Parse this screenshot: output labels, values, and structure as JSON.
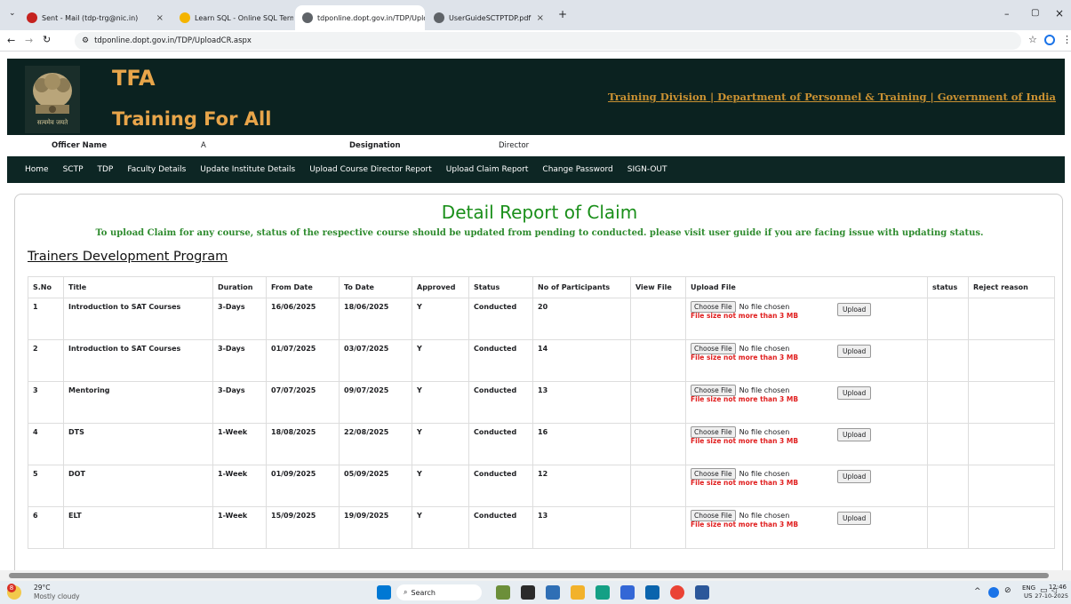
{
  "browser": {
    "tabs": [
      {
        "label": "Sent - Mail (tdp-trg@nic.in)",
        "color": "#c5221f"
      },
      {
        "label": "Learn SQL - Online SQL Termin",
        "color": "#f4b400"
      },
      {
        "label": "tdponline.dopt.gov.in/TDP/Uplo",
        "color": "#5f6368"
      },
      {
        "label": "UserGuideSCTPTDP.pdf",
        "color": "#5f6368"
      }
    ],
    "url": "tdponline.dopt.gov.in/TDP/UploadCR.aspx"
  },
  "header": {
    "logo_text": "TFA",
    "logo_subtext": "Training For All",
    "org": "Training Division | Department of Personnel & Training | Government of India",
    "emblem_caption": "सत्यमेव जयते"
  },
  "officer": {
    "name_label": "Officer Name",
    "name_value": "A",
    "designation_label": "Designation",
    "designation_value": "Director"
  },
  "nav": [
    "Home",
    "SCTP",
    "TDP",
    "Faculty Details",
    "Update Institute Details",
    "Upload Course Director Report",
    "Upload Claim Report",
    "Change Password",
    "SIGN-OUT"
  ],
  "content": {
    "title": "Detail Report of Claim",
    "note": "To upload Claim for any course, status of the respective course should be updated from pending to conducted. please visit user guide if you are facing issue with updating status.",
    "program_title": "Trainers Development Program",
    "columns": [
      "S.No",
      "Title",
      "Duration",
      "From Date",
      "To Date",
      "Approved",
      "Status",
      "No of Participants",
      "View File",
      "Upload File",
      "status",
      "Reject reason"
    ],
    "rows": [
      {
        "sno": "1",
        "title": "Introduction to SAT Courses",
        "duration": "3-Days",
        "from": "16/06/2025",
        "to": "18/06/2025",
        "approved": "Y",
        "status": "Conducted",
        "participants": "20"
      },
      {
        "sno": "2",
        "title": "Introduction to SAT Courses",
        "duration": "3-Days",
        "from": "01/07/2025",
        "to": "03/07/2025",
        "approved": "Y",
        "status": "Conducted",
        "participants": "14"
      },
      {
        "sno": "3",
        "title": "Mentoring",
        "duration": "3-Days",
        "from": "07/07/2025",
        "to": "09/07/2025",
        "approved": "Y",
        "status": "Conducted",
        "participants": "13"
      },
      {
        "sno": "4",
        "title": "DTS",
        "duration": "1-Week",
        "from": "18/08/2025",
        "to": "22/08/2025",
        "approved": "Y",
        "status": "Conducted",
        "participants": "16"
      },
      {
        "sno": "5",
        "title": "DOT",
        "duration": "1-Week",
        "from": "01/09/2025",
        "to": "05/09/2025",
        "approved": "Y",
        "status": "Conducted",
        "participants": "12"
      },
      {
        "sno": "6",
        "title": "ELT",
        "duration": "1-Week",
        "from": "15/09/2025",
        "to": "19/09/2025",
        "approved": "Y",
        "status": "Conducted",
        "participants": "13"
      }
    ],
    "choose_file_label": "Choose File",
    "no_file_label": "No file chosen",
    "file_size_note": "File size not more than 3 MB",
    "upload_label": "Upload"
  },
  "taskbar": {
    "temp": "29°C",
    "weather": "Mostly cloudy",
    "weather_badge": "8",
    "search": "Search",
    "lang1": "ENG",
    "lang2": "US",
    "time": "12:46",
    "date": "27-10-2025"
  }
}
